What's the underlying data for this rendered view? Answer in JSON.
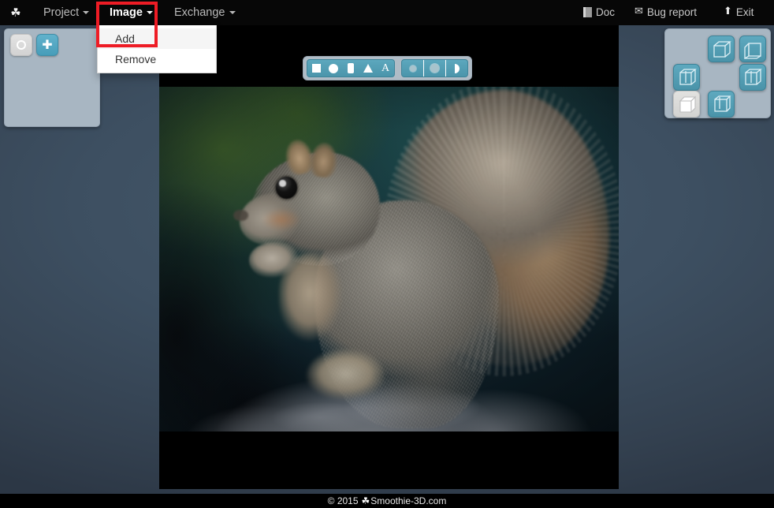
{
  "app": {
    "name": "Smoothie-3D",
    "logo_icon": "hand-logo-icon"
  },
  "menubar": {
    "left_items": [
      {
        "label": "Project",
        "has_caret": true
      },
      {
        "label": "Image",
        "has_caret": true
      },
      {
        "label": "Exchange",
        "has_caret": true
      }
    ],
    "right_items": [
      {
        "label": "Doc",
        "icon": "book-icon"
      },
      {
        "label": "Bug report",
        "icon": "envelope-icon"
      },
      {
        "label": "Exit",
        "icon": "up-arrow-icon"
      }
    ]
  },
  "dropdown": {
    "owner": "Image",
    "items": [
      {
        "label": "Add",
        "active": true
      },
      {
        "label": "Remove",
        "active": false
      }
    ]
  },
  "highlight": {
    "color": "#ee1c25",
    "target": "Image > Add"
  },
  "left_panel": {
    "buttons": [
      {
        "name": "rotate-tool",
        "icon": "ring-icon"
      },
      {
        "name": "move-tool",
        "icon": "move-arrows-icon"
      }
    ]
  },
  "shape_toolbar": {
    "group_one": [
      {
        "name": "square-tool",
        "icon": "square-icon"
      },
      {
        "name": "circle-tool",
        "icon": "circle-icon"
      },
      {
        "name": "rounded-rect-tool",
        "icon": "rounded-rect-icon"
      },
      {
        "name": "triangle-tool",
        "icon": "triangle-icon"
      },
      {
        "name": "text-tool",
        "icon": "letter-a-icon",
        "glyph": "A"
      }
    ],
    "group_two": [
      {
        "name": "small-dot-tool",
        "icon": "small-dot-icon"
      },
      {
        "name": "large-dot-tool",
        "icon": "large-dot-icon"
      },
      {
        "name": "half-disc-tool",
        "icon": "half-disc-icon"
      }
    ]
  },
  "view_panel": {
    "buttons": [
      {
        "name": "view-top",
        "state": "teal"
      },
      {
        "name": "view-top-right",
        "state": "teal"
      },
      {
        "name": "view-left",
        "state": "teal"
      },
      {
        "name": "view-right",
        "state": "teal"
      },
      {
        "name": "view-front",
        "state": "selected"
      },
      {
        "name": "view-bottom",
        "state": "teal"
      }
    ]
  },
  "canvas": {
    "image_alt": "squirrel-photo",
    "background": "#000000"
  },
  "footer": {
    "copyright": "© 2015",
    "site": "Smoothie-3D.com",
    "glyph": "logo-glyph"
  },
  "colors": {
    "menubar_bg": "#070707",
    "workspace_bg": "#3d4f61",
    "panel_bg": "#a8b6c2",
    "accent_teal": "#4b95ab",
    "highlight_red": "#ee1c25"
  }
}
